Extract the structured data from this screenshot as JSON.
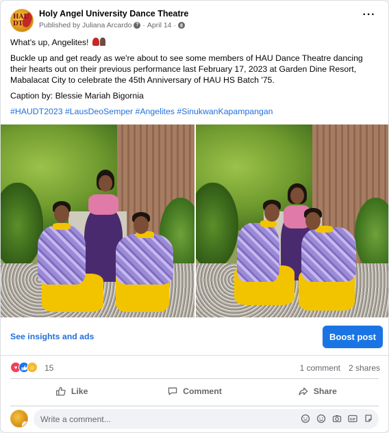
{
  "post": {
    "page_name": "Holy Angel University Dance Theatre",
    "published_by": "Published by Juliana Arcardo",
    "date": "April 14",
    "greeting": "What's up, Angelites!",
    "paragraph": "Buckle up and get ready as we're about to see some members of HAU Dance Theatre dancing their hearts out on their previous performance last February 17, 2023 at Garden Dine Resort, Mabalacat City to celebrate the 45th Anniversary of HAU HS Batch '75.",
    "caption": "Caption by: Blessie Mariah Bigornia",
    "hashtags": "#HAUDT2023 #LausDeoSemper #Angelites #SinukwanKapampangan",
    "avatar_text": "HAU DT"
  },
  "insights": {
    "link": "See insights and ads",
    "boost": "Boost post"
  },
  "stats": {
    "reactions": "15",
    "comments": "1 comment",
    "shares": "2 shares"
  },
  "actions": {
    "like": "Like",
    "comment": "Comment",
    "share": "Share"
  },
  "composer": {
    "placeholder": "Write a comment..."
  },
  "colors": {
    "link": "#216fdb",
    "boost": "#1b74e4",
    "muted": "#65676b"
  }
}
